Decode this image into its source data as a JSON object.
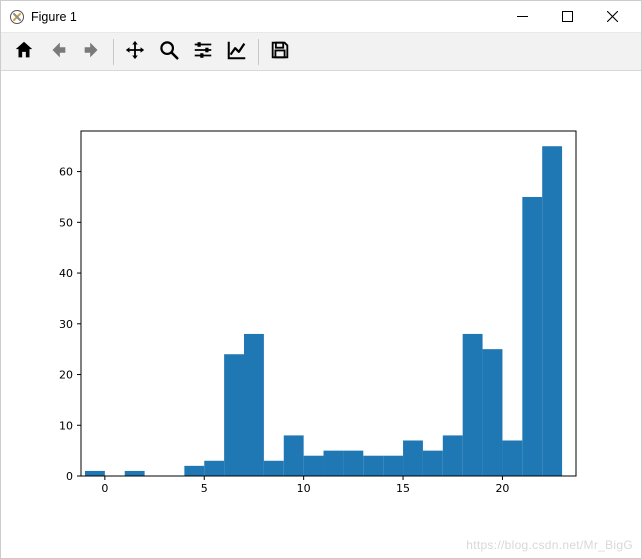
{
  "window": {
    "title": "Figure 1"
  },
  "watermark": "https://blog.csdn.net/Mr_BigG",
  "toolbar": {
    "home": "home-icon",
    "back": "back-icon",
    "forward": "forward-icon",
    "pan": "pan-icon",
    "zoom": "zoom-icon",
    "subplots": "subplots-icon",
    "edit": "edit-icon",
    "save": "save-icon"
  },
  "chart_data": {
    "type": "bar",
    "title": "",
    "xlabel": "",
    "ylabel": "",
    "xlim": [
      -1.2,
      23.7
    ],
    "ylim": [
      0,
      68
    ],
    "xticks": [
      0,
      5,
      10,
      15,
      20
    ],
    "yticks": [
      0,
      10,
      20,
      30,
      40,
      50,
      60
    ],
    "bin_edges": [
      -1,
      0,
      1,
      2,
      3,
      4,
      5,
      6,
      7,
      8,
      9,
      10,
      11,
      12,
      13,
      14,
      15,
      16,
      17,
      18,
      19,
      20,
      21,
      22,
      23
    ],
    "values": [
      1,
      0,
      1,
      0,
      0,
      2,
      3,
      24,
      28,
      3,
      8,
      4,
      5,
      5,
      4,
      4,
      7,
      5,
      8,
      28,
      25,
      7,
      55,
      65
    ],
    "bar_color": "#1f77b4",
    "edge_color": "#1f77b4"
  }
}
